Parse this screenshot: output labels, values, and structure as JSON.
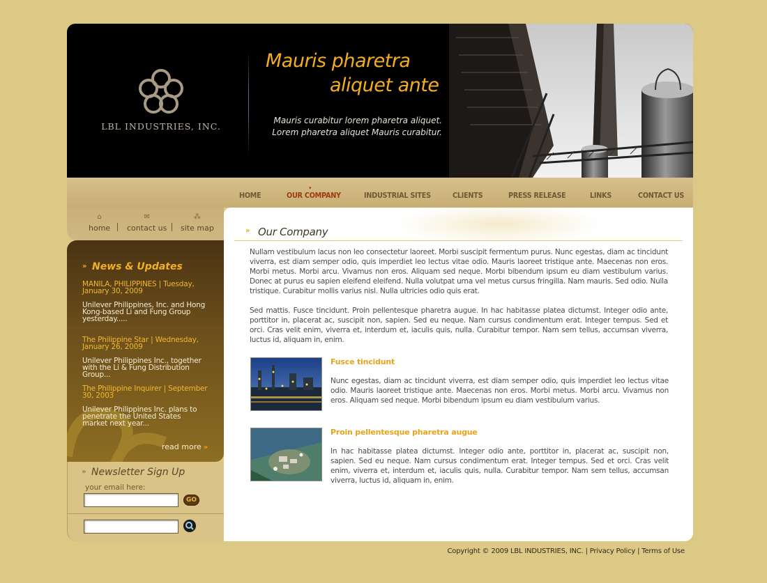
{
  "header": {
    "company_name": "LBL INDUSTRIES, INC.",
    "tagline_line1": "Mauris pharetra",
    "tagline_line2": "aliquet ante",
    "subtagline_line1": "Mauris curabitur lorem pharetra aliquet.",
    "subtagline_line2": "Lorem pharetra aliquet Mauris curabitur."
  },
  "nav": {
    "items": [
      {
        "label": "HOME"
      },
      {
        "label": "OUR COMPANY",
        "active": true
      },
      {
        "label": "INDUSTRIAL SITES"
      },
      {
        "label": "CLIENTS"
      },
      {
        "label": "PRESS RELEASE"
      },
      {
        "label": "LINKS"
      },
      {
        "label": "CONTACT US"
      }
    ]
  },
  "quick_links": [
    {
      "label": "home",
      "icon": "house-icon"
    },
    {
      "label": "contact us",
      "icon": "envelope-icon"
    },
    {
      "label": "site map",
      "icon": "sitemap-icon"
    }
  ],
  "news": {
    "title": "News & Updates",
    "items": [
      {
        "headline": "MANILA, PHILIPPINES | Tuesday, January 30, 2009",
        "body": "Unilever Philippines, Inc. and Hong Kong-based Li and Fung Group yesterday....."
      },
      {
        "headline": "The Philippine Star | Wednesday, January 26, 2009",
        "body": "Unilever Philippines Inc., together with the Li & Fung Distribution Group..."
      },
      {
        "headline": "The Philippine Inquirer | September 30, 2003",
        "body": "Unilever Philippines Inc. plans to penetrate the United States market next year..."
      }
    ],
    "read_more": "read more"
  },
  "newsletter": {
    "title": "Newsletter Sign Up",
    "email_label": "your email here:",
    "go_label": "GO"
  },
  "main": {
    "title": "Our Company",
    "paragraph1": "Nullam vestibulum lacus non leo consectetur laoreet. Morbi suscipit fermentum purus. Nunc egestas, diam ac tincidunt viverra, est diam semper odio, quis imperdiet leo lectus vitae odio. Mauris laoreet tristique ante. Maecenas non eros. Morbi metus. Morbi arcu. Vivamus non eros. Aliquam sed neque. Morbi bibendum ipsum eu diam vestibulum varius. Donec at purus eu sapien eleifend eleifend. Nulla volutpat urna vel metus cursus fringilla. Nam mauris. Sed odio. Nulla tristique. Curabitur mollis varius nisl. Nulla ultricies odio quis erat.",
    "paragraph2": "Sed mattis. Fusce tincidunt. Proin pellentesque pharetra augue. In hac habitasse platea dictumst. Integer odio ante, porttitor in, placerat ac, suscipit non, sapien. Sed eu neque. Nam cursus condimentum erat. Integer tempus. Sed et orci. Cras velit enim, viverra et, interdum et, iaculis quis, nulla. Curabitur tempor. Nam sem tellus, accumsan viverra, luctus id, aliquam in, enim.",
    "features": [
      {
        "title": "Fusce tincidunt",
        "text": "Nunc egestas, diam ac tincidunt viverra, est diam semper odio, quis imperdiet leo lectus vitae odio. Mauris laoreet tristique ante. Maecenas non eros. Morbi metus. Morbi arcu. Vivamus non eros. Aliquam sed neque. Morbi bibendum ipsum eu diam vestibulum varius."
      },
      {
        "title": "Proin pellentesque pharetra augue",
        "text": "In hac habitasse platea dictumst. Integer odio ante, porttitor in, placerat ac, suscipit non, sapien. Sed eu neque. Nam cursus condimentum erat. Integer tempus. Sed et orci. Cras velit enim, viverra et, interdum et, iaculis quis, nulla. Curabitur tempor. Nam sem tellus, accumsan viverra, luctus id, aliquam in, enim."
      }
    ]
  },
  "footer": {
    "copyright": "Copyright © 2009 LBL INDUSTRIES, INC.",
    "privacy": "Privacy Policy",
    "terms": "Terms of Use"
  },
  "colors": {
    "page_bg": "#dcc985",
    "accent_orange": "#f4ad1e",
    "nav_active": "#9b3a0b",
    "nav_text": "#6e5a32"
  }
}
